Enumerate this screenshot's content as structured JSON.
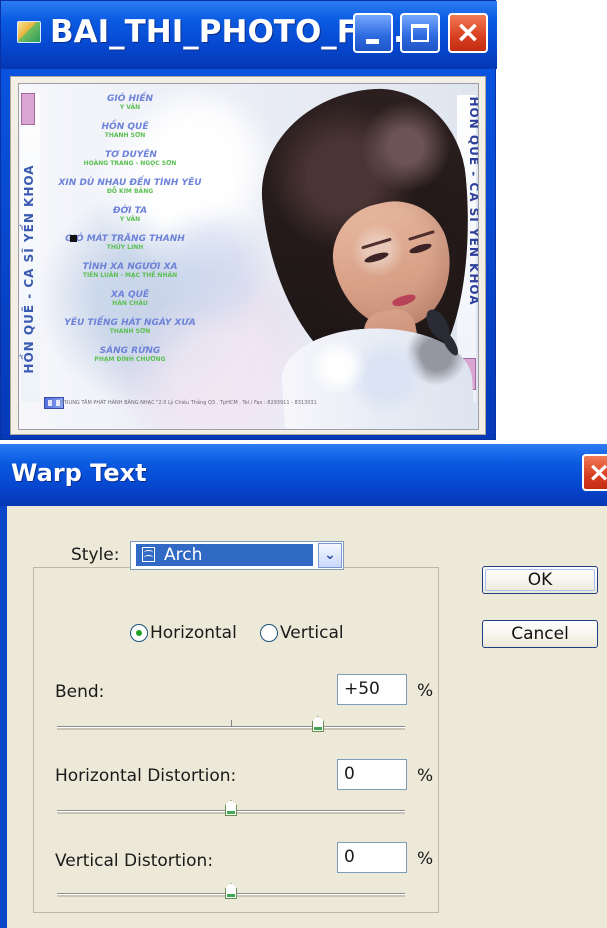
{
  "window": {
    "title": "BAI_THI_PHOTO_FI...",
    "icons": {
      "app": "image-editor-icon",
      "minimize": "minimize-icon",
      "maximize": "maximize-icon",
      "close": "close-icon"
    }
  },
  "album": {
    "left_spine": "HỒN QUÊ - CA SĨ YẾN KHOA",
    "right_spine": "HỒN QUÊ - CA SĨ YẾN KHOA",
    "tracks": [
      {
        "title": "GIÓ HIỀN",
        "artist": "Y VÂN"
      },
      {
        "title": "HỒN QUÊ",
        "artist": "THANH SƠN"
      },
      {
        "title": "TƠ DUYÊN",
        "artist": "HOÀNG TRANG - NGỌC SƠN"
      },
      {
        "title": "XIN DÙ NHAU ĐẾN TÌNH YÊU",
        "artist": "ĐỖ KIM BẢNG"
      },
      {
        "title": "ĐỜI TA",
        "artist": "Y VÂN"
      },
      {
        "title": "GIÓ MÁT TRĂNG THANH",
        "artist": "THÚY LINH"
      },
      {
        "title": "TÌNH XA NGƯỜI XA",
        "artist": "TIẾN LUÂN - MẠC THẾ NHÂN"
      },
      {
        "title": "XA QUÊ",
        "artist": "HÀN CHÂU"
      },
      {
        "title": "YÊU TIẾNG HÁT NGÀY XƯA",
        "artist": "THANH SƠN"
      },
      {
        "title": "SÁNG RỪNG",
        "artist": "PHẠM ĐÌNH CHƯƠNG"
      }
    ],
    "bottom_text": "TRUNG TÂM PHÁT HÀNH BĂNG NHẠC \"2.0 Lý Chiêu Thắng Q3 . TpHCM . Tel / Fax : 8293911 - 8313031"
  },
  "dialog": {
    "title": "Warp Text",
    "style_label": "Style:",
    "style_value": "Arch",
    "orientation": {
      "horizontal": "Horizontal",
      "vertical": "Vertical",
      "selected": "horizontal"
    },
    "bend": {
      "label": "Bend:",
      "value": "+50",
      "unit": "%",
      "slider_percent": 75
    },
    "horizontal_distortion": {
      "label": "Horizontal Distortion:",
      "value": "0",
      "unit": "%",
      "slider_percent": 50
    },
    "vertical_distortion": {
      "label": "Vertical Distortion:",
      "value": "0",
      "unit": "%",
      "slider_percent": 50
    },
    "buttons": {
      "ok": "OK",
      "cancel": "Cancel"
    },
    "icons": {
      "close": "close-icon",
      "style": "arch-icon",
      "dropdown": "chevron-down-icon",
      "radio": "radio-button-icon",
      "slider": "slider-thumb-icon"
    }
  },
  "colors": {
    "xp_blue": "#0a5be1",
    "dialog_background": "#ece9d8",
    "selection_blue": "#316ac5",
    "track_title": "#6d82d8",
    "track_artist": "#5bbf52"
  }
}
